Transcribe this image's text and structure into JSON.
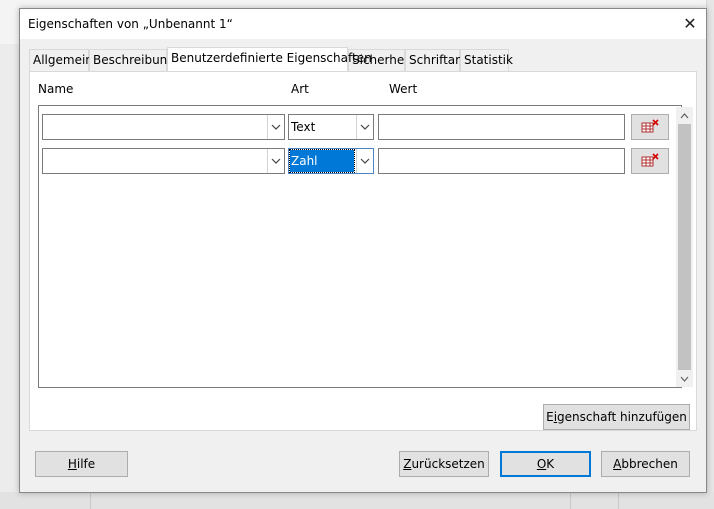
{
  "dialog": {
    "title": "Eigenschaften von „Unbenannt 1“",
    "close_glyph": "✕"
  },
  "tabs": [
    {
      "label": "Allgemein",
      "active": false
    },
    {
      "label": "Beschreibung",
      "active": false
    },
    {
      "label": "Benutzerdefinierte Eigenschaften",
      "active": true
    },
    {
      "label": "Sicherheit",
      "active": false
    },
    {
      "label": "Schriftart",
      "active": false
    },
    {
      "label": "Statistik",
      "active": false
    }
  ],
  "columns": {
    "name": "Name",
    "type": "Art",
    "value": "Wert"
  },
  "rows": [
    {
      "name": "",
      "type": "Text",
      "value": "",
      "type_selected": false
    },
    {
      "name": "",
      "type": "Zahl",
      "value": "",
      "type_selected": true
    }
  ],
  "icons": {
    "combo_arrow": "chevron-down-icon",
    "delete_row": "delete-property-icon",
    "scroll_up": "chevron-up-icon",
    "scroll_down": "chevron-down-icon"
  },
  "buttons": {
    "add_property": {
      "pre": "E",
      "mnemonic": "i",
      "post": "genschaft hinzufügen"
    },
    "help": {
      "pre": "",
      "mnemonic": "H",
      "post": "ilfe"
    },
    "reset": {
      "pre": "",
      "mnemonic": "Z",
      "post": "urücksetzen"
    },
    "ok": {
      "pre": "",
      "mnemonic": "O",
      "post": "K"
    },
    "cancel": {
      "pre": "",
      "mnemonic": "A",
      "post": "bbrechen"
    }
  },
  "colors": {
    "selection": "#0078d7",
    "default_button_border": "#0078d7",
    "delete_icon_red": "#d40000"
  }
}
